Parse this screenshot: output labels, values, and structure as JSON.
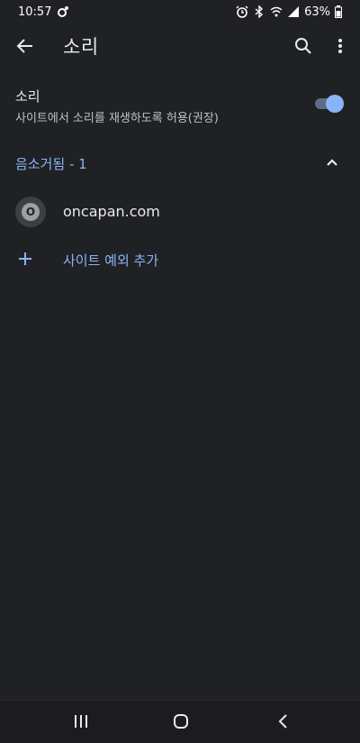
{
  "status_bar": {
    "time": "10:57",
    "battery": "63%",
    "icons": [
      "app-notification-icon",
      "alarm-icon",
      "bluetooth-icon",
      "wifi-icon",
      "signal-icon",
      "battery-icon"
    ]
  },
  "app_bar": {
    "title": "소리",
    "icons": [
      "back-arrow-icon",
      "search-icon",
      "more-vert-icon"
    ]
  },
  "setting": {
    "title": "소리",
    "subtitle": "사이트에서 소리를 재생하도록 허용(권장)",
    "enabled": true
  },
  "section": {
    "title": "음소거됨 - 1",
    "expanded": true
  },
  "sites": [
    {
      "avatar_letter": "O",
      "name": "oncapan.com"
    }
  ],
  "add_exception": {
    "label": "사이트 예외 추가"
  },
  "nav_bar": {
    "icons": [
      "recents-icon",
      "home-icon",
      "back-icon"
    ]
  },
  "colors": {
    "background": "#202124",
    "accent": "#8ab4f8",
    "text_primary": "#e8eaed",
    "text_secondary": "#bdc1c6"
  }
}
